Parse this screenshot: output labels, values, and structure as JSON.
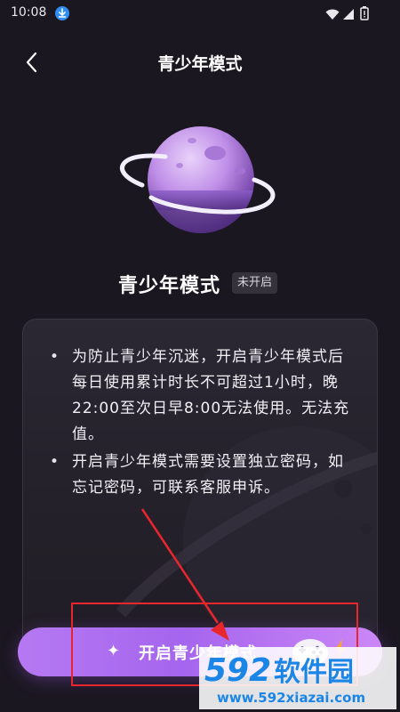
{
  "status_bar": {
    "time": "10:08"
  },
  "header": {
    "title": "青少年模式"
  },
  "mode": {
    "title": "青少年模式",
    "status": "未开启"
  },
  "info": {
    "items": [
      "为防止青少年沉迷，开启青少年模式后每日使用累计时长不可超过1小时，晚22:00至次日早8:00无法使用。无法充值。",
      "开启青少年模式需要设置独立密码，如忘记密码，可联系客服申诉。"
    ]
  },
  "action": {
    "enable_label": "开启青少年模式"
  },
  "watermark": {
    "brand_number": "592",
    "brand_text": "软件园",
    "url": "www.592xiazai.com"
  },
  "colors": {
    "background": "#1b1721",
    "accent": "#b679f2",
    "highlight": "#e8262c",
    "watermark_blue": "#1c86e6"
  }
}
